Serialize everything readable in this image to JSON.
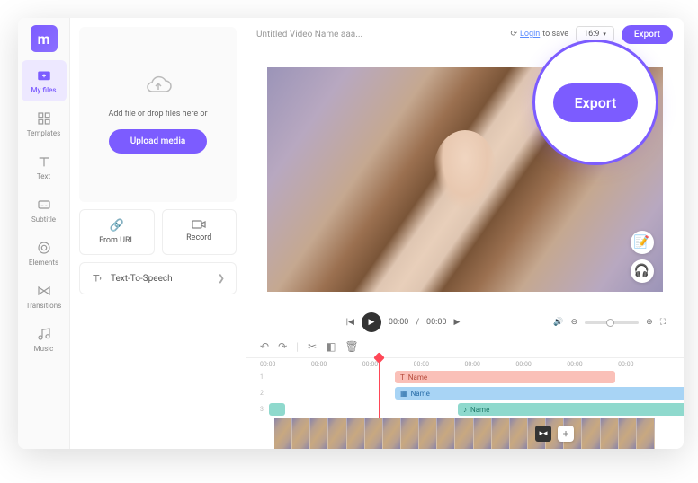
{
  "logo": "m",
  "nav": [
    {
      "label": "My files",
      "active": true
    },
    {
      "label": "Templates"
    },
    {
      "label": "Text"
    },
    {
      "label": "Subtitle"
    },
    {
      "label": "Elements"
    },
    {
      "label": "Transitions"
    },
    {
      "label": "Music"
    }
  ],
  "upload": {
    "hint": "Add file or drop files here or",
    "button": "Upload media"
  },
  "panel_buttons": {
    "from_url": "From URL",
    "record": "Record"
  },
  "tts_label": "Text-To-Speech",
  "project_title": "Untitled Video Name aaa...",
  "login": {
    "link": "Login",
    "rest": "to save"
  },
  "aspect": "16:9",
  "export_btn": "Export",
  "playback": {
    "current": "00:00",
    "total": "00:00"
  },
  "ruler": [
    "00:00",
    "00:00",
    "00:00",
    "00:00",
    "00:00",
    "00:00",
    "00:00",
    "00:00"
  ],
  "tracks": {
    "t1_label": "Name",
    "t2_label": "Name",
    "t3_label": "Name"
  },
  "callout_label": "Export"
}
